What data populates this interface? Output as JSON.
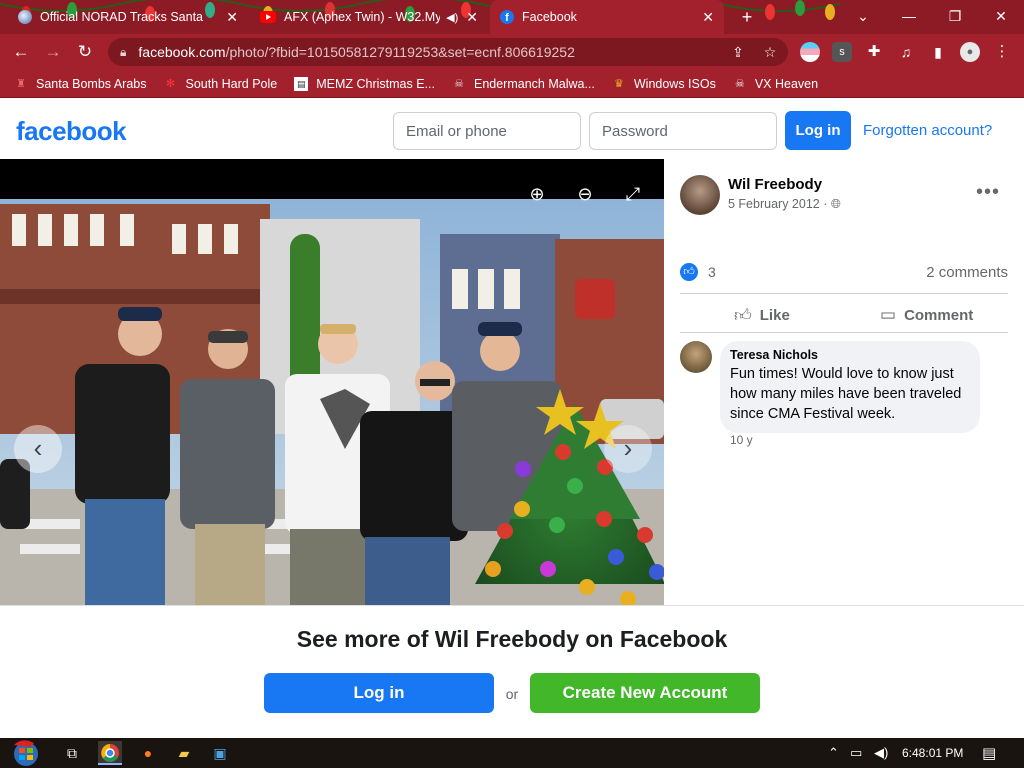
{
  "browser": {
    "tabs": [
      {
        "title": "Official NORAD Tracks Santa",
        "icon": "norad-icon"
      },
      {
        "title": "AFX (Aphex Twin) - W32.My",
        "icon": "youtube-icon"
      },
      {
        "title": "Facebook",
        "icon": "facebook-icon",
        "active": true
      }
    ],
    "url_main": "facebook.com",
    "url_rest": "/photo/?fbid=10150581279119253&set=ecnf.806619252",
    "bookmarks": [
      {
        "label": "Santa Bombs Arabs",
        "icon": "figure-icon"
      },
      {
        "label": "South Hard Pole",
        "icon": "snowflake-icon"
      },
      {
        "label": "MEMZ Christmas E...",
        "icon": "page-icon"
      },
      {
        "label": "Endermanch Malwa...",
        "icon": "skull-icon"
      },
      {
        "label": "Windows ISOs",
        "icon": "trophy-icon"
      },
      {
        "label": "VX Heaven",
        "icon": "skull-icon"
      }
    ],
    "ext_letter": "s"
  },
  "fb": {
    "logo": "facebook",
    "email_placeholder": "Email or phone",
    "password_placeholder": "Password",
    "login_label": "Log in",
    "forgot_label": "Forgotten account?"
  },
  "post": {
    "author": "Wil Freebody",
    "date": "5 February 2012 ·",
    "like_count": "3",
    "comment_count": "2 comments",
    "like_action": "Like",
    "comment_action": "Comment",
    "comment": {
      "author": "Teresa Nichols",
      "text": "Fun times! Would love to know just how many miles have been traveled since CMA Festival week.",
      "time": "10 y"
    }
  },
  "banner": {
    "title": "See more of Wil Freebody on Facebook",
    "login_label": "Log in",
    "or": "or",
    "create_label": "Create New Account"
  },
  "taskbar": {
    "clock": "6:48:01 PM"
  },
  "colors": {
    "chrome_frame": "#8c1b25",
    "chrome_toolbar": "#a3212d",
    "fb_blue": "#1877f2",
    "fb_green": "#42b72a"
  }
}
